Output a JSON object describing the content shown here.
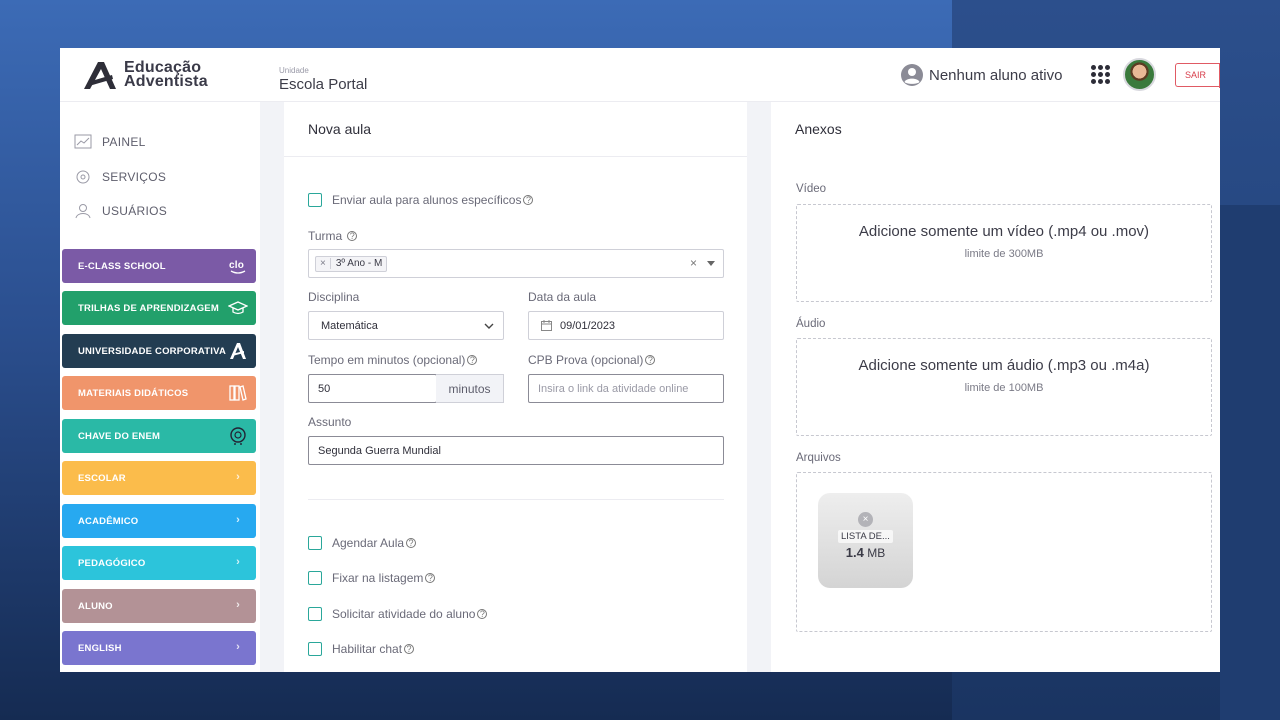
{
  "header": {
    "brand_line1": "Educação",
    "brand_line2": "Adventista",
    "unit_label": "Unidade",
    "unit_name": "Escola Portal",
    "student_status": "Nenhum aluno ativo",
    "logout_label": "SAIR"
  },
  "sidebar": {
    "nav": [
      {
        "label": "PAINEL",
        "icon": "chart-icon"
      },
      {
        "label": "SERVIÇOS",
        "icon": "services-icon"
      },
      {
        "label": "USUÁRIOS",
        "icon": "users-icon"
      }
    ],
    "modules": [
      {
        "label": "E-CLASS SCHOOL",
        "color": "#7b5aa6",
        "icon": "clo-icon"
      },
      {
        "label": "TRILHAS DE APRENDIZAGEM",
        "color": "#22a06b",
        "icon": "graduation-cap-icon"
      },
      {
        "label": "UNIVERSIDADE CORPORATIVA",
        "color": "#233d52",
        "icon": "adventista-logo-icon"
      },
      {
        "label": "MATERIAIS DIDÁTICOS",
        "color": "#f0956b",
        "icon": "books-icon"
      },
      {
        "label": "CHAVE DO ENEM",
        "color": "#2ab9a6",
        "icon": "brain-icon"
      },
      {
        "label": "ESCOLAR",
        "color": "#fbbc4b",
        "icon": "chevron-right-icon"
      },
      {
        "label": "ACADÊMICO",
        "color": "#27a9f0",
        "icon": "chevron-right-icon"
      },
      {
        "label": "PEDAGÓGICO",
        "color": "#2cc4db",
        "icon": "chevron-right-icon"
      },
      {
        "label": "ALUNO",
        "color": "#b39296",
        "icon": "chevron-right-icon"
      },
      {
        "label": "ENGLISH",
        "color": "#7a75cf",
        "icon": "chevron-right-icon"
      }
    ]
  },
  "form": {
    "title": "Nova aula",
    "send_specific": "Enviar aula para alunos específicos",
    "class_label": "Turma",
    "class_tag": "3º Ano - M",
    "subject_label": "Disciplina",
    "subject_value": "Matemática",
    "date_label": "Data da aula",
    "date_value": "09/01/2023",
    "time_label": "Tempo em minutos (opcional)",
    "time_value": "50",
    "time_unit": "minutos",
    "cpb_label": "CPB Prova (opcional)",
    "cpb_placeholder": "Insira o link da atividade online",
    "topic_label": "Assunto",
    "topic_value": "Segunda Guerra Mundial",
    "options": [
      "Agendar Aula",
      "Fixar na listagem",
      "Solicitar atividade do aluno",
      "Habilitar chat"
    ]
  },
  "attachments": {
    "title": "Anexos",
    "video_label": "Vídeo",
    "video_title": "Adicione somente um vídeo (.mp4 ou .mov)",
    "video_limit": "limite de 300MB",
    "audio_label": "Áudio",
    "audio_title": "Adicione somente um áudio (.mp3 ou .m4a)",
    "audio_limit": "limite de 100MB",
    "files_label": "Arquivos",
    "file_name": "LISTA DE...",
    "file_size_num": "1.4",
    "file_size_unit": "MB"
  }
}
